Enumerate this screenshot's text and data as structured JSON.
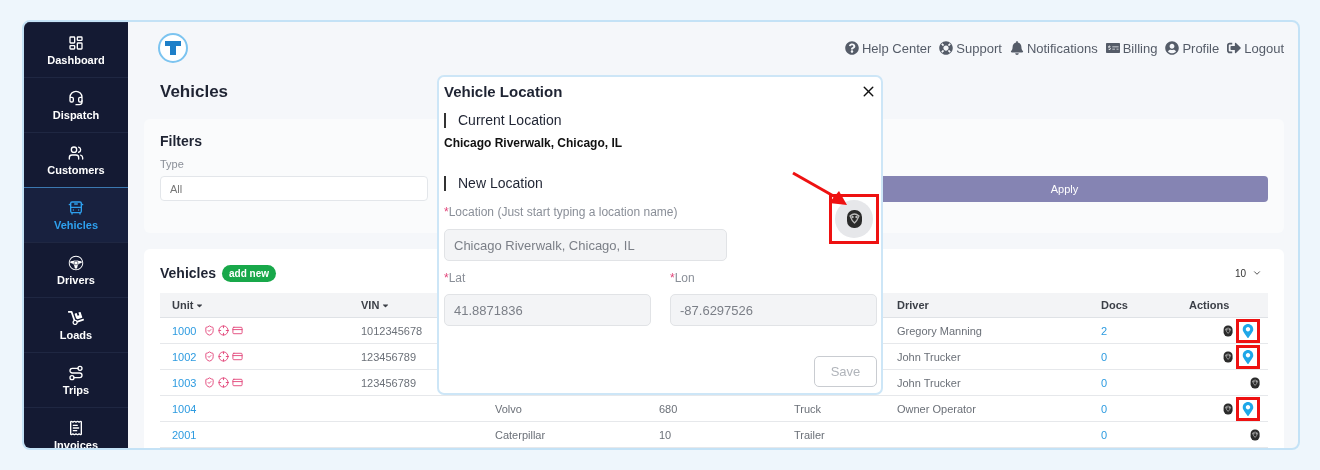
{
  "sidebar": {
    "items": [
      {
        "kind": "dashboard",
        "label": "Dashboard",
        "selected": false
      },
      {
        "kind": "dispatch",
        "label": "Dispatch",
        "selected": false
      },
      {
        "kind": "customers",
        "label": "Customers",
        "selected": false
      },
      {
        "kind": "vehicles",
        "label": "Vehicles",
        "selected": true
      },
      {
        "kind": "drivers",
        "label": "Drivers",
        "selected": false
      },
      {
        "kind": "loads",
        "label": "Loads",
        "selected": false
      },
      {
        "kind": "trips",
        "label": "Trips",
        "selected": false
      },
      {
        "kind": "invoices",
        "label": "Invoices",
        "selected": false
      }
    ]
  },
  "top_links": [
    {
      "kind": "help",
      "label": "Help Center"
    },
    {
      "kind": "support",
      "label": "Support"
    },
    {
      "kind": "notifications",
      "label": "Notifications"
    },
    {
      "kind": "billing",
      "label": "Billing"
    },
    {
      "kind": "profile",
      "label": "Profile"
    },
    {
      "kind": "logout",
      "label": "Logout"
    }
  ],
  "page_title": "Vehicles",
  "filters": {
    "title": "Filters",
    "type_label": "Type",
    "type_value": "All",
    "apply_button": "Apply"
  },
  "vehicles": {
    "title": "Vehicles",
    "add_button": "add new",
    "page_size": "10",
    "columns": [
      {
        "label": "Unit",
        "sortable": true
      },
      {
        "label": "VIN",
        "sortable": true
      },
      {
        "label": "Driver",
        "sortable": false
      },
      {
        "label": "Docs",
        "sortable": false
      },
      {
        "label": "Actions",
        "sortable": false
      }
    ],
    "rows": [
      {
        "unit": "1000",
        "flags": true,
        "vin": "1012345678",
        "driver": "Gregory Manning",
        "docs": "2",
        "location": true,
        "highlighted": true
      },
      {
        "unit": "1002",
        "flags": true,
        "vin": "123456789",
        "driver": "John Trucker",
        "docs": "0",
        "location": true,
        "highlighted": true
      },
      {
        "unit": "1003",
        "flags": true,
        "vin": "123456789",
        "driver": "John Trucker",
        "docs": "0",
        "location": false
      },
      {
        "unit": "1004",
        "flags": false,
        "column_3": "Volvo",
        "column_4": "680",
        "column_5": "Truck",
        "driver": "Owner Operator",
        "docs": "0",
        "location": true,
        "highlighted": true
      },
      {
        "unit": "2001",
        "flags": false,
        "column_3": "Caterpillar",
        "column_4": "10",
        "column_5": "Trailer",
        "docs": "0",
        "location": false
      }
    ]
  },
  "modal": {
    "title": "Vehicle Location",
    "current_heading": "Current Location",
    "current_value": "Chicago Riverwalk, Chicago, IL",
    "new_heading": "New Location",
    "location": {
      "required_mark": "*",
      "label": "Location",
      "hint": "(Just start typing a location name)",
      "value": "Chicago Riverwalk, Chicago, IL",
      "disabled": true
    },
    "pick_button_highlighted": true,
    "lat": {
      "required_mark": "*",
      "label": "Lat",
      "value": "41.8871836",
      "disabled": true
    },
    "lon": {
      "required_mark": "*",
      "label": "Lon",
      "value": "-87.6297526",
      "disabled": true
    },
    "save_button": "Save",
    "save_disabled": true
  }
}
